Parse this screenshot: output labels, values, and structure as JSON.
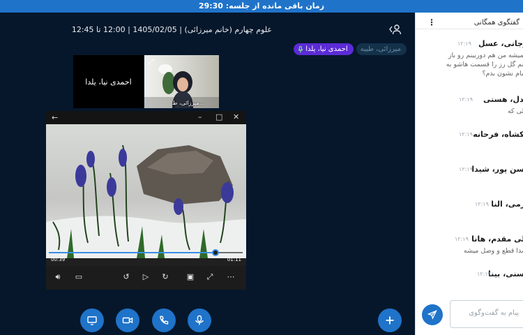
{
  "topbar": {
    "remaining_label": "زمان باقی مانده از جلسه: 29:30"
  },
  "meeting": {
    "title": "علوم چهارم (خانم میرزائی) | 1405/02/05 | 12:00 تا 12:45"
  },
  "participants": {
    "pills": [
      {
        "label": "میرزائی، طیبه",
        "style": "gray"
      },
      {
        "label": "احمدی نیا، یلدا",
        "style": "purple",
        "mic": true
      }
    ]
  },
  "tiles": {
    "name_tile": "احمدی نیا، یلدا",
    "camera_tile": "میرزائی، ط..."
  },
  "player": {
    "time_elapsed": "00:39",
    "time_total": "01:11",
    "progress": 0.86
  },
  "toolbar": {
    "buttons": [
      "screen-share",
      "camera",
      "phone",
      "microphone"
    ],
    "add_button": "+"
  },
  "chat": {
    "title": "گفتگوی همگانی",
    "messages": [
      {
        "name": "ارجانی، عسل",
        "time": "۱۲:۱۹",
        "lines": [
          "همیشه من هم دوربینم رو باز",
          "کنم گل رز را قسمت هاشو به",
          "تمام نشون بدم؟"
        ]
      },
      {
        "name": "بیدل، هستی",
        "time": "۱۲:۱۹",
        "lines": [
          "ولی که"
        ]
      },
      {
        "name": "نیکشاه، فرحانه",
        "time": "۱۲:۱۹",
        "lines": [
          "ه"
        ]
      },
      {
        "name": "حسن پور، شیدا",
        "time": "۱۲:۱۹",
        "lines": [
          "ه"
        ]
      },
      {
        "name": "کرمی، النا",
        "time": "۱۲:۱۹",
        "lines": [
          "ه"
        ]
      },
      {
        "name": "قلی مقدم، هانا",
        "time": "۱۲:۱۹",
        "lines": [
          "صدا قطع و وصل میشه"
        ]
      },
      {
        "name": "حسنی، بینا",
        "time": "۱۲:۱۹",
        "lines": [
          "ه"
        ]
      }
    ],
    "input_placeholder": "پیام به گفت‌وگوی"
  },
  "colors": {
    "accent": "#1f73c9",
    "background": "#06172b",
    "pill_active": "#5b2bd6"
  }
}
